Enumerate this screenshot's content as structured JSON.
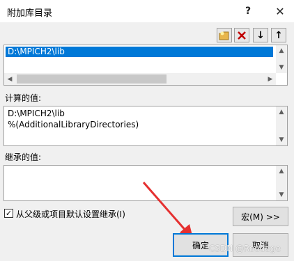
{
  "window": {
    "title": "附加库目录",
    "help": "?",
    "close": "✕"
  },
  "toolbar": {
    "new_folder": "new-folder-icon",
    "delete": "delete-icon",
    "move_down": "↓",
    "move_up": "↑",
    "delete_color": "#c00000",
    "folder_color": "#e8b64a"
  },
  "edit_list": {
    "items": [
      "D:\\MPICH2\\lib"
    ],
    "selected_color": "#0078d7"
  },
  "computed": {
    "label": "计算的值:",
    "lines": [
      "D:\\MPICH2\\lib",
      "%(AdditionalLibraryDirectories)"
    ]
  },
  "inherited": {
    "label": "继承的值:"
  },
  "inherit_checkbox": {
    "label": "从父级或项目默认设置继承(I)",
    "checked": true
  },
  "buttons": {
    "macro": "宏(M) >>",
    "ok": "确定",
    "cancel": "取消"
  },
  "watermark": "CSDN @Roudage",
  "scroll": {
    "up": "▲",
    "down": "▼",
    "left": "◀",
    "right": "▶"
  }
}
